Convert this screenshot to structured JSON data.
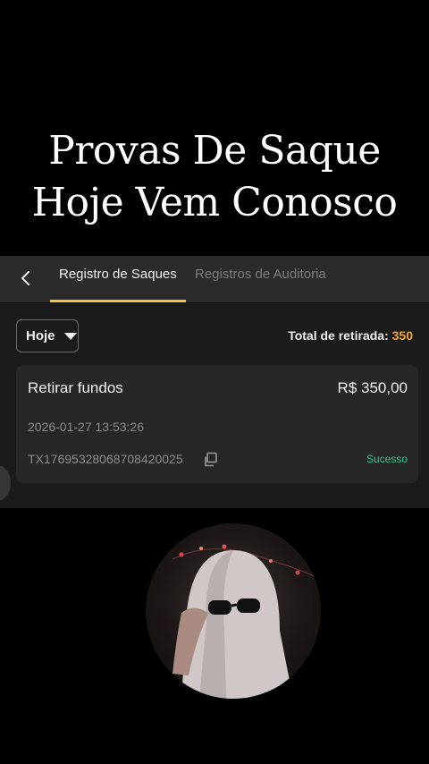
{
  "overlay": {
    "line1": "Provas De Saque",
    "line2": "Hoje Vem Conosco"
  },
  "header": {
    "back_icon": "chevron-left-icon",
    "tabs": [
      {
        "label": "Registro de Saques",
        "active": true
      },
      {
        "label": "Registros de Auditoria",
        "active": false
      }
    ],
    "accent": "#f5c542"
  },
  "filter": {
    "selected": "Hoje"
  },
  "summary": {
    "label": "Total de retirada:",
    "value": "350",
    "value_color": "#f5a623"
  },
  "transaction": {
    "title": "Retirar fundos",
    "amount": "R$ 350,00",
    "datetime": "2026-01-27 13:53:26",
    "tx_id": "TX17695328068708420025",
    "copy_icon": "copy-icon",
    "status": "Sucesso",
    "status_color": "#2bc48a"
  }
}
